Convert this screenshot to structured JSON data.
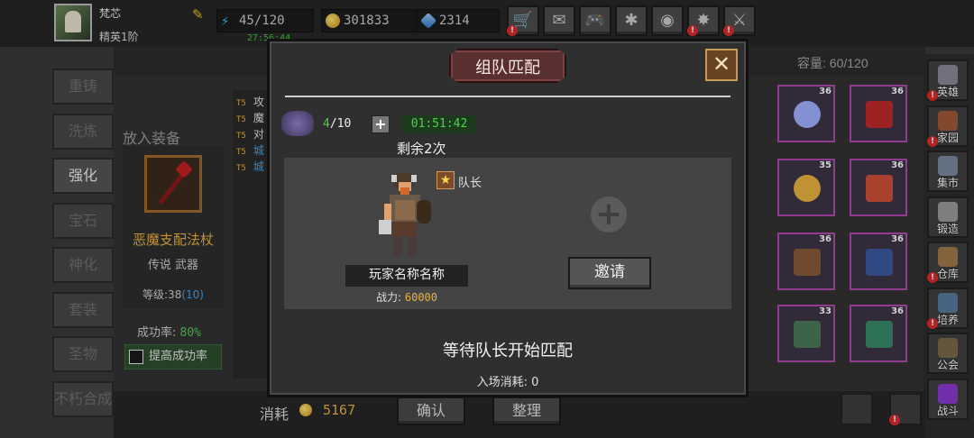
{
  "header": {
    "player_name": "梵芯",
    "rank": "精英1阶",
    "energy": "45/120",
    "energy_timer": "27:56:44",
    "gold": "301833",
    "gems": "2314",
    "buttons": [
      {
        "name": "shop-button",
        "icon": "cart-icon",
        "glyph": "🛒",
        "badge": "!"
      },
      {
        "name": "mail-button",
        "icon": "mail-icon",
        "glyph": "✉",
        "badge": ""
      },
      {
        "name": "gamepad-button",
        "icon": "gamepad-icon",
        "glyph": "🎮",
        "badge": ""
      },
      {
        "name": "settings-button",
        "icon": "gear-icon",
        "glyph": "✱",
        "badge": ""
      },
      {
        "name": "wheel-button",
        "icon": "color-wheel-icon",
        "glyph": "◉",
        "badge": ""
      },
      {
        "name": "event-button",
        "icon": "burst-icon",
        "glyph": "✸",
        "badge": "!"
      },
      {
        "name": "battle-button",
        "icon": "crossed-swords-icon",
        "glyph": "⚔",
        "badge": "!"
      }
    ]
  },
  "left_tabs": [
    {
      "label": "重铸",
      "active": false
    },
    {
      "label": "洗炼",
      "active": false
    },
    {
      "label": "强化",
      "active": true
    },
    {
      "label": "宝石",
      "active": false
    },
    {
      "label": "神化",
      "active": false
    },
    {
      "label": "套装",
      "active": false
    },
    {
      "label": "圣物",
      "active": false
    },
    {
      "label": "不朽合成",
      "active": false
    }
  ],
  "forge": {
    "put_equip_label": "放入装备",
    "item_name": "恶魔支配法杖",
    "item_type": "传说 武器",
    "level_label": "等级:38",
    "level_extra": "(10)",
    "success_rate_label": "成功率:",
    "success_rate_value": "80%",
    "boost_button": "提高成功率"
  },
  "log": [
    {
      "tag": "T5",
      "text": "攻",
      "color": "#e0e0e0"
    },
    {
      "tag": "T5",
      "text": "魔",
      "color": "#e0e0e0"
    },
    {
      "tag": "T5",
      "text": "对",
      "color": "#e0e0e0"
    },
    {
      "tag": "T5",
      "text": "城",
      "color": "#3fa7f0"
    },
    {
      "tag": "T5",
      "text": "城",
      "color": "#3fa7f0"
    }
  ],
  "inventory": {
    "capacity": "容量: 60/120",
    "slots": [
      {
        "level": "36",
        "art": "amulet",
        "color": "#a0b0ff"
      },
      {
        "level": "36",
        "art": "boots",
        "color": "#c02a2a"
      },
      {
        "level": "35",
        "art": "ring",
        "color": "#e8b341"
      },
      {
        "level": "36",
        "art": "gloves",
        "color": "#d0503a"
      },
      {
        "level": "36",
        "art": "helmet",
        "color": "#8a5a3a"
      },
      {
        "level": "36",
        "art": "cloak",
        "color": "#3a5aa0"
      },
      {
        "level": "33",
        "art": "crossbow",
        "color": "#4a7a5a"
      },
      {
        "level": "36",
        "art": "greaves",
        "color": "#3a8a6a"
      }
    ]
  },
  "right_nav": [
    {
      "label": "英雄",
      "color": "#8a8a9a",
      "badge": "!"
    },
    {
      "label": "家园",
      "color": "#a05a3a",
      "badge": "!"
    },
    {
      "label": "集市",
      "color": "#7a8aa0",
      "badge": ""
    },
    {
      "label": "锻造",
      "color": "#9a9a9a",
      "badge": ""
    },
    {
      "label": "仓库",
      "color": "#a07a4a",
      "badge": "!"
    },
    {
      "label": "培养",
      "color": "#5a7aa0",
      "badge": "!"
    },
    {
      "label": "公会",
      "color": "#7a6a4a",
      "badge": ""
    },
    {
      "label": "战斗",
      "color": "#8a3ad0",
      "badge": ""
    }
  ],
  "bottom": {
    "consume_label": "消耗",
    "consume_value": "5167",
    "confirm_button": "确认",
    "sort_button": "整理"
  },
  "modal": {
    "title": "组队匹配",
    "tickets_current": "4",
    "tickets_total": "/10",
    "add_label": "+",
    "timer": "01:51:42",
    "remaining": "剩余2次",
    "captain_label": "队长",
    "player_name": "玩家名称名称",
    "power_label": "战力:",
    "power_value": "60000",
    "invite_button": "邀请",
    "waiting_text": "等待队长开始匹配",
    "entry_cost": "入场消耗: 0"
  }
}
